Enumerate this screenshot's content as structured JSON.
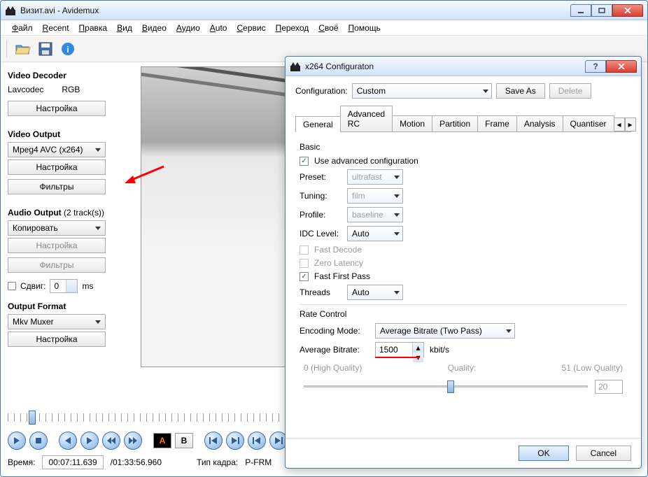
{
  "window": {
    "title": "Визит.avi - Avidemux"
  },
  "menu": {
    "items": [
      "Файл",
      "Recent",
      "Правка",
      "Вид",
      "Видео",
      "Аудио",
      "Auto",
      "Сервис",
      "Переход",
      "Своё",
      "Помощь"
    ]
  },
  "left": {
    "video_decoder_title": "Video Decoder",
    "lavcodec": "Lavcodec",
    "rgb": "RGB",
    "video_output_title": "Video Output",
    "video_codec": "Mpeg4 AVC (x264)",
    "configure": "Настройка",
    "filters": "Фильтры",
    "audio_output_title": "Audio Output",
    "audio_tracks": "(2 track(s))",
    "audio_codec": "Копировать",
    "shift_label": "Сдвиг:",
    "shift_value": "0",
    "shift_unit": "ms",
    "output_format_title": "Output Format",
    "output_format": "Mkv Muxer"
  },
  "bottom": {
    "time_label": "Время:",
    "time_current": "00:07:11.639",
    "time_total": "/01:33:56.960",
    "frame_type_label": "Тип кадра:",
    "frame_type": "P-FRM"
  },
  "modal": {
    "title": "x264 Configuraton",
    "config_label": "Configuration:",
    "config_value": "Custom",
    "save_as": "Save As",
    "delete": "Delete",
    "tabs": [
      "General",
      "Advanced RC",
      "Motion",
      "Partition",
      "Frame",
      "Analysis",
      "Quantiser"
    ],
    "basic_title": "Basic",
    "use_advanced": "Use advanced configuration",
    "preset_label": "Preset:",
    "preset_value": "ultrafast",
    "tuning_label": "Tuning:",
    "tuning_value": "film",
    "profile_label": "Profile:",
    "profile_value": "baseline",
    "idc_label": "IDC Level:",
    "idc_value": "Auto",
    "fast_decode": "Fast Decode",
    "zero_latency": "Zero Latency",
    "fast_first_pass": "Fast First Pass",
    "threads_label": "Threads",
    "threads_value": "Auto",
    "rate_title": "Rate Control",
    "encoding_mode_label": "Encoding Mode:",
    "encoding_mode_value": "Average Bitrate (Two Pass)",
    "avg_bitrate_label": "Average Bitrate:",
    "avg_bitrate_value": "1500",
    "avg_bitrate_unit": "kbit/s",
    "q_high": "0 (High Quality)",
    "q_label": "Quality:",
    "q_low": "51 (Low Quality)",
    "q_value": "20",
    "ok": "OK",
    "cancel": "Cancel"
  }
}
